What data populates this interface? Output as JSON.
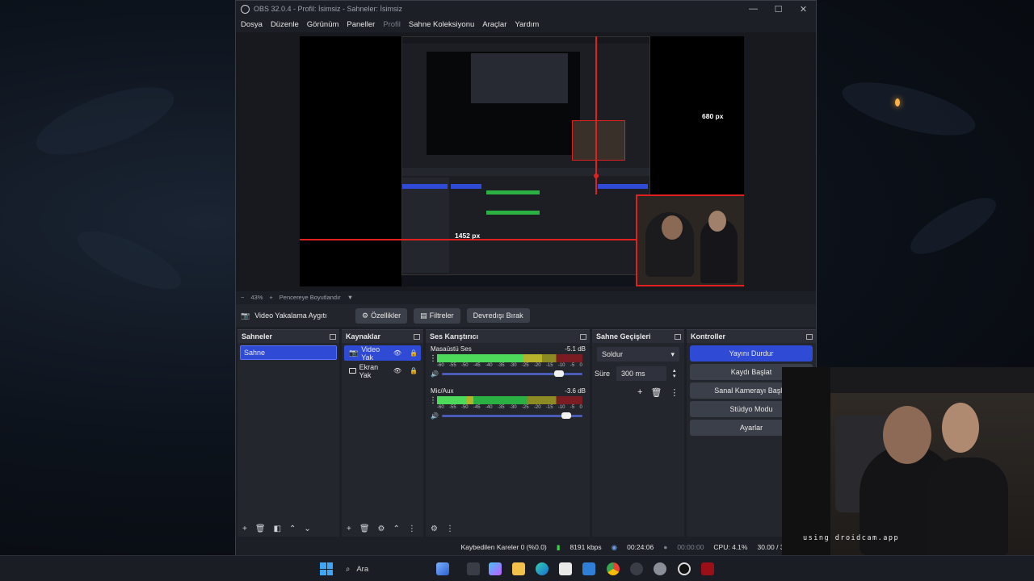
{
  "window": {
    "title": "OBS 32.0.4 - Profil: İsimsiz - Sahneler: İsimsiz",
    "controls": [
      "—",
      "☐",
      "✕"
    ]
  },
  "menu": [
    "Dosya",
    "Düzenle",
    "Görünüm",
    "Paneller",
    "Profil",
    "Sahne Koleksiyonu",
    "Araçlar",
    "Yardım"
  ],
  "preview": {
    "label_width": "1452 px",
    "label_height": "680 px"
  },
  "zoom": {
    "minus": "−",
    "value": "43%",
    "plus": "+",
    "mode": "Pencereye Boyutlandır"
  },
  "source_toolbar": {
    "source_name": "Video Yakalama Aygıtı",
    "properties": "Özellikler",
    "filters": "Filtreler",
    "deactivate": "Devredışı Bırak"
  },
  "scenes": {
    "title": "Sahneler",
    "items": [
      "Sahne"
    ]
  },
  "sources": {
    "title": "Kaynaklar",
    "items": [
      "Video Yak",
      "Ekran Yak"
    ]
  },
  "mixer": {
    "title": "Ses Karıştırıcı",
    "channels": [
      {
        "name": "Masaüstü Ses",
        "db": "-5.1 dB",
        "level": 0.72,
        "volume": 0.87
      },
      {
        "name": "Mic/Aux",
        "db": "-3.6 dB",
        "level": 0.25,
        "volume": 0.92
      }
    ],
    "ticks": [
      "-60",
      "-55",
      "-50",
      "-45",
      "-40",
      "-35",
      "-30",
      "-25",
      "-20",
      "-15",
      "-10",
      "-5",
      "0"
    ]
  },
  "transitions": {
    "title": "Sahne Geçişleri",
    "selected": "Soldur",
    "duration_label": "Süre",
    "duration": "300 ms"
  },
  "controls": {
    "title": "Kontroller",
    "buttons": [
      "Yayını Durdur",
      "Kaydı Başlat",
      "Sanal Kamerayı Başlat",
      "Stüdyo Modu",
      "Ayarlar"
    ]
  },
  "status": {
    "dropped": "Kaybedilen Kareler 0 (%0.0)",
    "bitrate": "8191 kbps",
    "stream_time": "00:24:06",
    "rec_time": "00:00:00",
    "cpu": "CPU: 4.1%",
    "fps": "30.00 / 30.00 FPS"
  },
  "webcam": {
    "watermark": "using droidcam.app"
  },
  "taskbar": {
    "search": "Ara"
  },
  "colors": {
    "accent": "#2f4bd6",
    "guide_red": "#e0201e"
  }
}
